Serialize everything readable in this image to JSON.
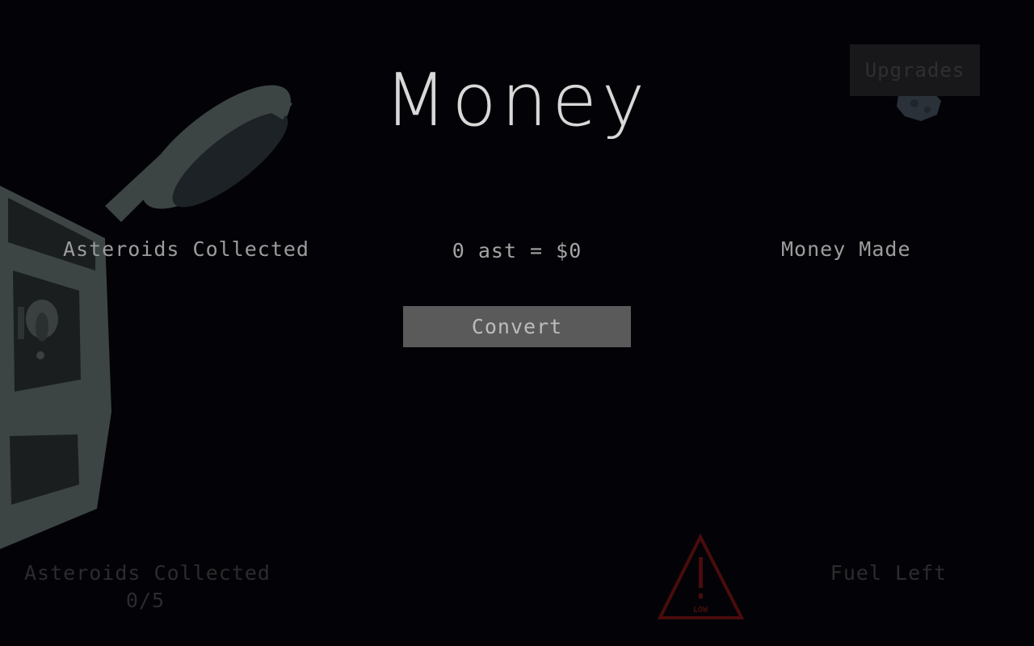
{
  "screen": {
    "title": "Money",
    "upgrades_label": "Upgrades"
  },
  "conversion": {
    "asteroids_label": "Asteroids Collected",
    "rate_text": "0 ast = $0",
    "money_label": "Money Made",
    "convert_label": "Convert"
  },
  "hud": {
    "asteroids_label": "Asteroids Collected",
    "asteroids_count": "0/5",
    "fuel_label": "Fuel Left",
    "fuel_warning": "LOW"
  },
  "colors": {
    "background": "#030307",
    "ship_hull": "#3c4444",
    "warning": "#4a0c0c"
  }
}
